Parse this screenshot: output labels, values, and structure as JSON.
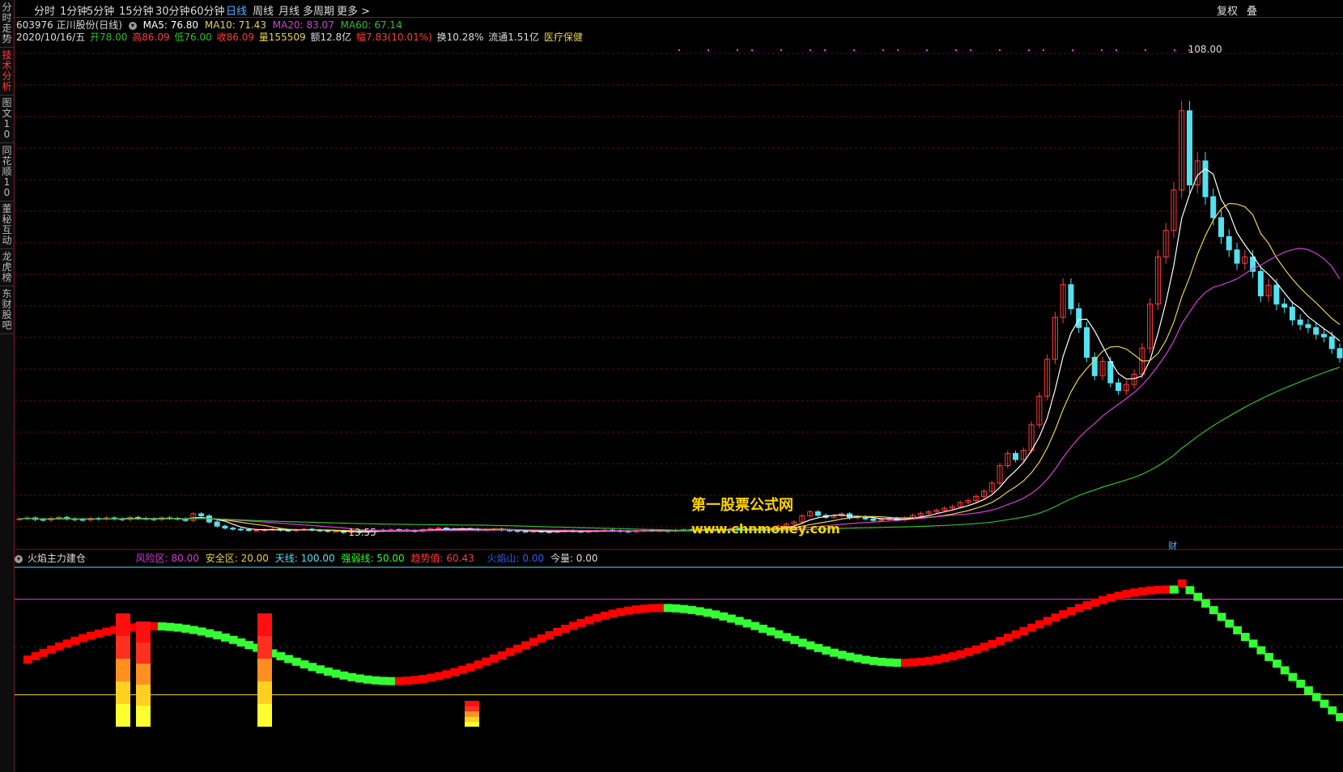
{
  "sidebar": {
    "tabs": [
      {
        "label": "分时走势",
        "active": false
      },
      {
        "label": "技术分析",
        "active": true
      },
      {
        "label": "图文10",
        "active": false
      },
      {
        "label": "同花顺10",
        "active": false
      },
      {
        "label": "董秘互动",
        "active": false
      },
      {
        "label": "龙虎榜",
        "active": false
      },
      {
        "label": "东财股吧",
        "active": false
      }
    ]
  },
  "toolbar": {
    "periods": [
      "分时",
      "1分钟",
      "5分钟",
      "15分钟",
      "30分钟",
      "60分钟",
      "日线",
      "周线",
      "月线",
      "多周期",
      "更多 >"
    ],
    "active_period": "日线",
    "right_buttons": [
      "复权",
      "叠"
    ]
  },
  "stock": {
    "code_name": "603976 正川股份(日线)",
    "ma5": "MA5: 76.80",
    "ma10": "MA10: 71.43",
    "ma20": "MA20: 83.07",
    "ma60": "MA60: 67.14",
    "date": "2020/10/16/五",
    "open": "开78.00",
    "high": "高86.09",
    "low": "低76.00",
    "close": "收86.09",
    "volume": "量155509",
    "amount": "额12.8亿",
    "change": "幅7.83(10.01%)",
    "turnover": "换10.28%",
    "float": "流通1.51亿",
    "sector": "医疗保健",
    "max_label": "108.00",
    "min_label": "13.55"
  },
  "watermark": {
    "line1": "第一股票公式网",
    "line2": "www.chnmoney.com"
  },
  "cai_label": "财",
  "indicator": {
    "name": "火焰主力建仓",
    "risk": "风险区: 80.00",
    "safe": "安全区: 20.00",
    "sky": "天线: 100.00",
    "strength": "强弱线: 50.00",
    "trend": "趋势值: 60.43",
    "fire": "火焰山: 0.00",
    "vol": "今量: 0.00"
  },
  "colors": {
    "up": "#ff3b3b",
    "down": "#54e1f0",
    "ma5": "#ffffff",
    "ma10": "#e6d34a",
    "ma20": "#d63fd6",
    "ma60": "#2fbf2f",
    "trend_up": "#ff0000",
    "trend_down": "#33ff33",
    "grid": "#5a0f0f"
  },
  "chart_data": {
    "type": "candlestick",
    "y_max_label": 108.0,
    "y_min_label": 13.55,
    "close": [
      16.2,
      16.4,
      16.1,
      16.0,
      16.3,
      16.5,
      16.2,
      16.1,
      16.0,
      16.3,
      16.2,
      16.4,
      16.2,
      16.1,
      16.5,
      16.3,
      16.2,
      16.1,
      16.4,
      16.3,
      16.2,
      15.9,
      17.2,
      16.8,
      15.6,
      14.8,
      14.4,
      14.2,
      14.1,
      14.0,
      14.0,
      14.1,
      14.2,
      14.0,
      13.9,
      14.1,
      14.2,
      14.0,
      13.9,
      13.8,
      13.8,
      13.55,
      13.7,
      13.6,
      13.8,
      14.0,
      13.9,
      14.1,
      14.0,
      13.9,
      13.8,
      14.1,
      14.3,
      14.4,
      14.2,
      14.1,
      14.3,
      14.2,
      14.0,
      14.1,
      14.2,
      14.0,
      13.9,
      13.8,
      13.7,
      13.8,
      13.7,
      13.6,
      13.8,
      13.9,
      13.8,
      13.7,
      13.8,
      13.9,
      14.0,
      13.9,
      13.8,
      13.7,
      13.9,
      14.0,
      13.9,
      13.9,
      13.8,
      14.0,
      14.1,
      14.0,
      14.2,
      14.1,
      14.0,
      14.1,
      14.3,
      14.2,
      14.1,
      14.2,
      14.0,
      14.4,
      14.8,
      15.2,
      15.6,
      16.8,
      17.6,
      16.9,
      16.5,
      16.8,
      17.2,
      16.4,
      16.6,
      16.2,
      15.9,
      16.1,
      16.3,
      16.0,
      16.4,
      16.9,
      17.3,
      17.6,
      17.9,
      18.3,
      18.6,
      19.4,
      19.8,
      20.6,
      21.6,
      23.2,
      26.6,
      29.0,
      27.8,
      29.6,
      34.6,
      40.2,
      47.4,
      55.6,
      62.0,
      57.3,
      53.6,
      47.8,
      44.2,
      47.0,
      42.8,
      41.3,
      42.5,
      44.5,
      49.6,
      58.2,
      67.4,
      72.6,
      80.5,
      96.0,
      81.5,
      86.2,
      79.2,
      75.1,
      71.4,
      68.8,
      66.2,
      67.4,
      64.6,
      59.8,
      61.9,
      58.2,
      57.6,
      55.1,
      54.2,
      53.6,
      52.3,
      51.8,
      49.5,
      47.7
    ]
  }
}
